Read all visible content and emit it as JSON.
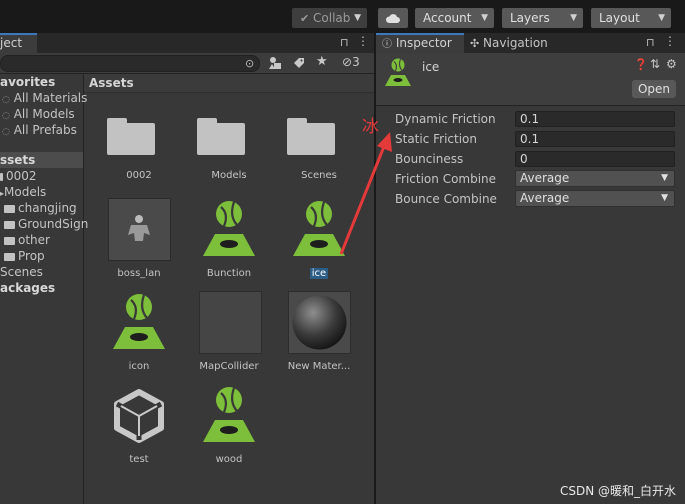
{
  "toolbar": {
    "collab": "Collab",
    "account": "Account",
    "layers": "Layers",
    "layout": "Layout"
  },
  "project": {
    "tab_label": "ject",
    "filter_count": "3",
    "tree": [
      {
        "label": "avorites",
        "bold": true
      },
      {
        "label": "All Materials"
      },
      {
        "label": "All Models"
      },
      {
        "label": "All Prefabs"
      },
      {
        "label": "ssets",
        "bold": true,
        "selected": true
      },
      {
        "label": "0002"
      },
      {
        "label": "Models"
      },
      {
        "label": "changjing"
      },
      {
        "label": "GroundSign"
      },
      {
        "label": "other"
      },
      {
        "label": "Prop"
      },
      {
        "label": "Scenes"
      },
      {
        "label": "ackages",
        "bold": true
      }
    ],
    "assets_header": "Assets",
    "assets": [
      {
        "name": "0002",
        "kind": "folder"
      },
      {
        "name": "Models",
        "kind": "folder"
      },
      {
        "name": "Scenes",
        "kind": "folder"
      },
      {
        "name": "boss_lan",
        "kind": "model"
      },
      {
        "name": "Bunction",
        "kind": "physic-material"
      },
      {
        "name": "ice",
        "kind": "physic-material",
        "selected": true
      },
      {
        "name": "icon",
        "kind": "physic-material"
      },
      {
        "name": "MapCollider",
        "kind": "empty"
      },
      {
        "name": "New Mater...",
        "kind": "material"
      },
      {
        "name": "test",
        "kind": "unity"
      },
      {
        "name": "wood",
        "kind": "physic-material"
      }
    ]
  },
  "inspector": {
    "tab_label": "Inspector",
    "nav_tab_label": "Navigation",
    "asset_name": "ice",
    "open_button": "Open",
    "properties": [
      {
        "label": "Dynamic Friction",
        "value": "0.1",
        "type": "field"
      },
      {
        "label": "Static Friction",
        "value": "0.1",
        "type": "field"
      },
      {
        "label": "Bounciness",
        "value": "0",
        "type": "field"
      },
      {
        "label": "Friction Combine",
        "value": "Average",
        "type": "dropdown"
      },
      {
        "label": "Bounce Combine",
        "value": "Average",
        "type": "dropdown"
      }
    ]
  },
  "annotation": {
    "char": "冰",
    "color": "#e53a3a"
  },
  "watermark": "CSDN @暖和_白开水",
  "colors": {
    "accent": "#3a79bb",
    "physic_green": "#7dbf3b",
    "selection": "#2c5d87"
  }
}
